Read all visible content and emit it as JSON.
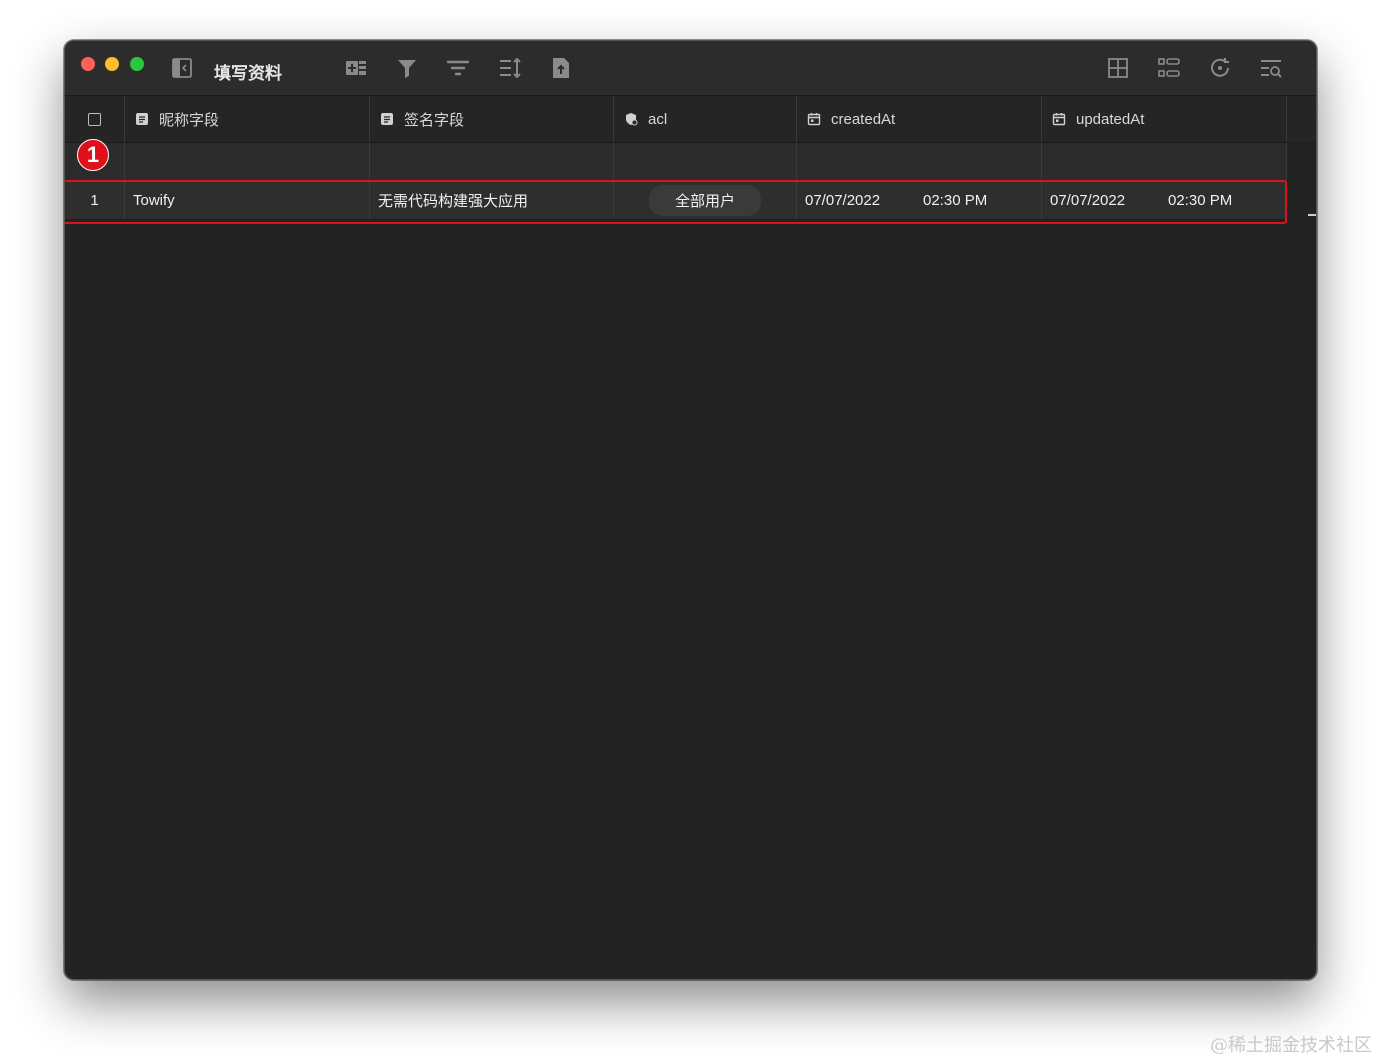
{
  "window": {
    "title": "填写资料",
    "toolbar_icons": [
      "sidebar-toggle-icon",
      "add-record-icon",
      "filter-icon",
      "field-filter-icon",
      "sort-icon",
      "export-icon"
    ],
    "right_icons": [
      "layout-icon",
      "fields-icon",
      "refresh-icon",
      "search-icon"
    ]
  },
  "table": {
    "columns": [
      {
        "label": "昵称字段",
        "icon": "text-field-icon"
      },
      {
        "label": "签名字段",
        "icon": "text-field-icon"
      },
      {
        "label": "acl",
        "icon": "acl-icon"
      },
      {
        "label": "createdAt",
        "icon": "calendar-icon"
      },
      {
        "label": "updatedAt",
        "icon": "calendar-icon"
      }
    ],
    "rows": [
      {
        "index": "1",
        "nickname": "Towify",
        "signature": "无需代码构建强大应用",
        "acl": "全部用户",
        "created_date": "07/07/2022",
        "created_time": "02:30 PM",
        "updated_date": "07/07/2022",
        "updated_time": "02:30 PM"
      }
    ]
  },
  "annotation": {
    "badge": "1",
    "color": "#e0101b"
  },
  "watermark": "@稀土掘金技术社区"
}
